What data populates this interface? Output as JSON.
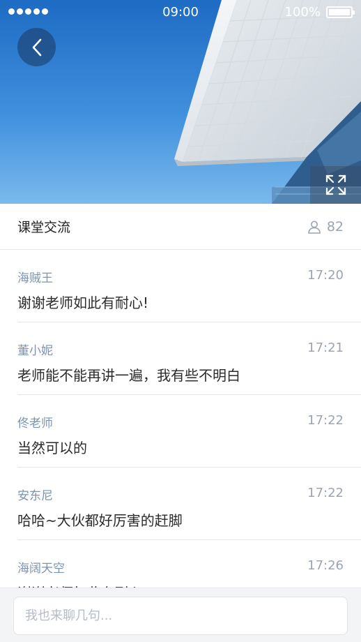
{
  "status_bar": {
    "time": "09:00",
    "battery": "100%",
    "signal_bars": 5
  },
  "hero": {
    "back_icon": "chevron-left-icon",
    "fullscreen_icon": "expand-icon"
  },
  "header": {
    "title": "课堂交流",
    "participant_icon": "user-icon",
    "participant_count": "82"
  },
  "messages": [
    {
      "sender": "海贼王",
      "time": "17:20",
      "text": "谢谢老师如此有耐心!"
    },
    {
      "sender": "董小妮",
      "time": "17:21",
      "text": "老师能不能再讲一遍，我有些不明白"
    },
    {
      "sender": "佟老师",
      "time": "17:22",
      "text": "当然可以的"
    },
    {
      "sender": "安东尼",
      "time": "17:22",
      "text": "哈哈~大伙都好厉害的赶脚"
    },
    {
      "sender": "海阔天空",
      "time": "17:26",
      "text": "谢谢老师如此有耐心!"
    }
  ],
  "input": {
    "placeholder": "我也来聊几句..."
  },
  "colors": {
    "sender": "#7e93ad",
    "time": "#9aa4b2",
    "sky": "#3f8fdd"
  }
}
